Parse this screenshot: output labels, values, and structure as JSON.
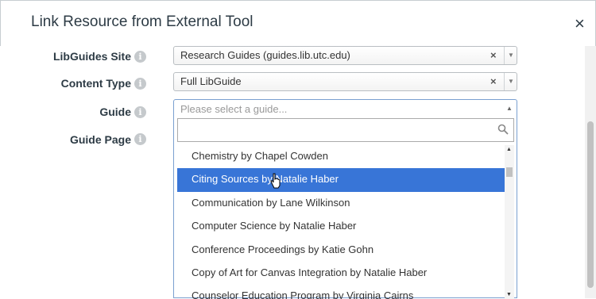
{
  "dialog": {
    "title": "Link Resource from External Tool",
    "close_symbol": "×"
  },
  "form": {
    "libguides_site": {
      "label": "LibGuides Site",
      "value": "Research Guides (guides.lib.utc.edu)",
      "info_icon": "info-icon"
    },
    "content_type": {
      "label": "Content Type",
      "value": "Full LibGuide",
      "info_icon": "info-icon"
    },
    "guide": {
      "label": "Guide",
      "placeholder": "Please select a guide...",
      "info_icon": "info-icon"
    },
    "guide_page": {
      "label": "Guide Page",
      "info_icon": "info-icon"
    }
  },
  "dropdown": {
    "search_value": "",
    "highlighted_index": 1,
    "items": [
      "Chemistry by Chapel Cowden",
      "Citing Sources by Natalie Haber",
      "Communication by Lane Wilkinson",
      "Computer Science by Natalie Haber",
      "Conference Proceedings by Katie Gohn",
      "Copy of Art for Canvas Integration by Natalie Haber",
      "Counselor Education Program by Virginia Cairns"
    ]
  },
  "colors": {
    "highlight": "#3875d7",
    "text": "#2d3b45"
  }
}
